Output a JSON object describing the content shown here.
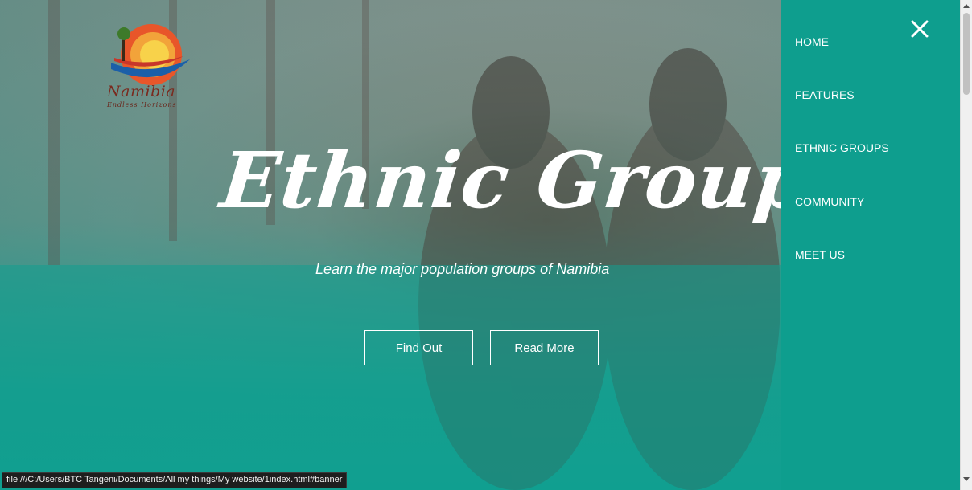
{
  "banner": {
    "logo": {
      "icon": "namibia-logo-icon",
      "title": "Namibia",
      "tagline": "Endless Horizons"
    },
    "headline": "Ethnic Groups",
    "subheadline": "Learn the major population groups of Namibia",
    "buttons": {
      "find_out": "Find Out",
      "read_more": "Read More"
    }
  },
  "side_menu": {
    "close_icon": "close-icon",
    "items": [
      {
        "label": "HOME"
      },
      {
        "label": "FEATURES"
      },
      {
        "label": "ETHNIC GROUPS"
      },
      {
        "label": "COMMUNITY"
      },
      {
        "label": "MEET US"
      }
    ]
  },
  "status_bar": {
    "url": "file:///C:/Users/BTC Tangeni/Documents/All my things/My website/1index.html#banner"
  },
  "colors": {
    "menu_background": "#0e9e8e",
    "banner_overlay": "#0f9f90",
    "text": "#ffffff"
  }
}
